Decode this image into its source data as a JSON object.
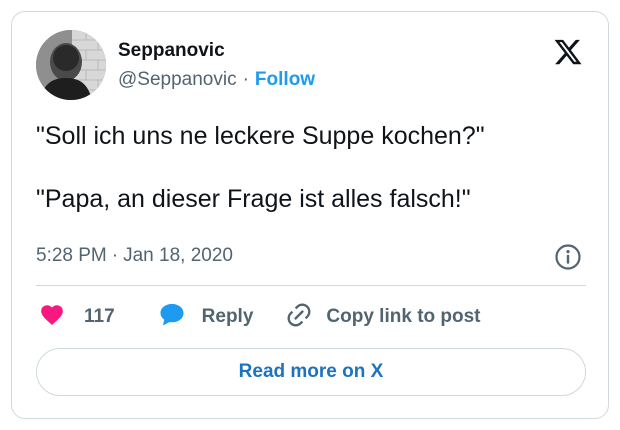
{
  "author": {
    "display_name": "Seppanovic",
    "handle": "@Seppanovic",
    "separator": "·",
    "follow_label": "Follow"
  },
  "tweet": {
    "lines": [
      "\"Soll ich uns ne leckere Suppe kochen?\"",
      "\"Papa, an dieser Frage ist alles falsch!\""
    ],
    "time": "5:28 PM",
    "separator": "·",
    "date": "Jan 18, 2020"
  },
  "actions": {
    "like_count": "117",
    "reply_label": "Reply",
    "copy_label": "Copy link to post"
  },
  "footer": {
    "read_more_label": "Read more on X"
  },
  "icons": {
    "logo": "x-logo-icon",
    "info": "info-icon",
    "like": "heart-icon",
    "reply": "speech-bubble-icon",
    "copy": "link-icon"
  },
  "colors": {
    "link_blue": "#1d9bf0",
    "read_more_blue": "#1d73be",
    "heart_pink": "#f91880",
    "secondary_text": "#536471",
    "border": "#cfd9de"
  }
}
